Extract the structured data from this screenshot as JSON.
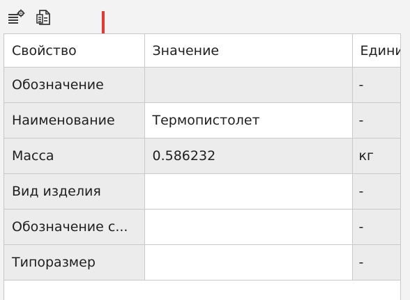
{
  "toolbar": {
    "buttons": [
      {
        "name": "property-settings",
        "icon": "list-gear-icon"
      },
      {
        "name": "copy-properties",
        "icon": "document-list-icon"
      }
    ]
  },
  "table": {
    "headers": [
      "Свойство",
      "Значение",
      "Едини"
    ],
    "rows": [
      {
        "property": "Обозначение",
        "value": "",
        "unit": "-"
      },
      {
        "property": "Наименование",
        "value": "Термопистолет",
        "unit": "-"
      },
      {
        "property": "Масса",
        "value": "0.586232",
        "unit": "кг"
      },
      {
        "property": "Вид изделия",
        "value": "",
        "unit": "-"
      },
      {
        "property": "Обозначение с...",
        "value": "",
        "unit": "-"
      },
      {
        "property": "Типоразмер",
        "value": "",
        "unit": "-"
      }
    ]
  },
  "colors": {
    "annotation_arrow": "#e53935",
    "readonly_cell": "#ececec",
    "grid_line": "#c9c9c9"
  }
}
